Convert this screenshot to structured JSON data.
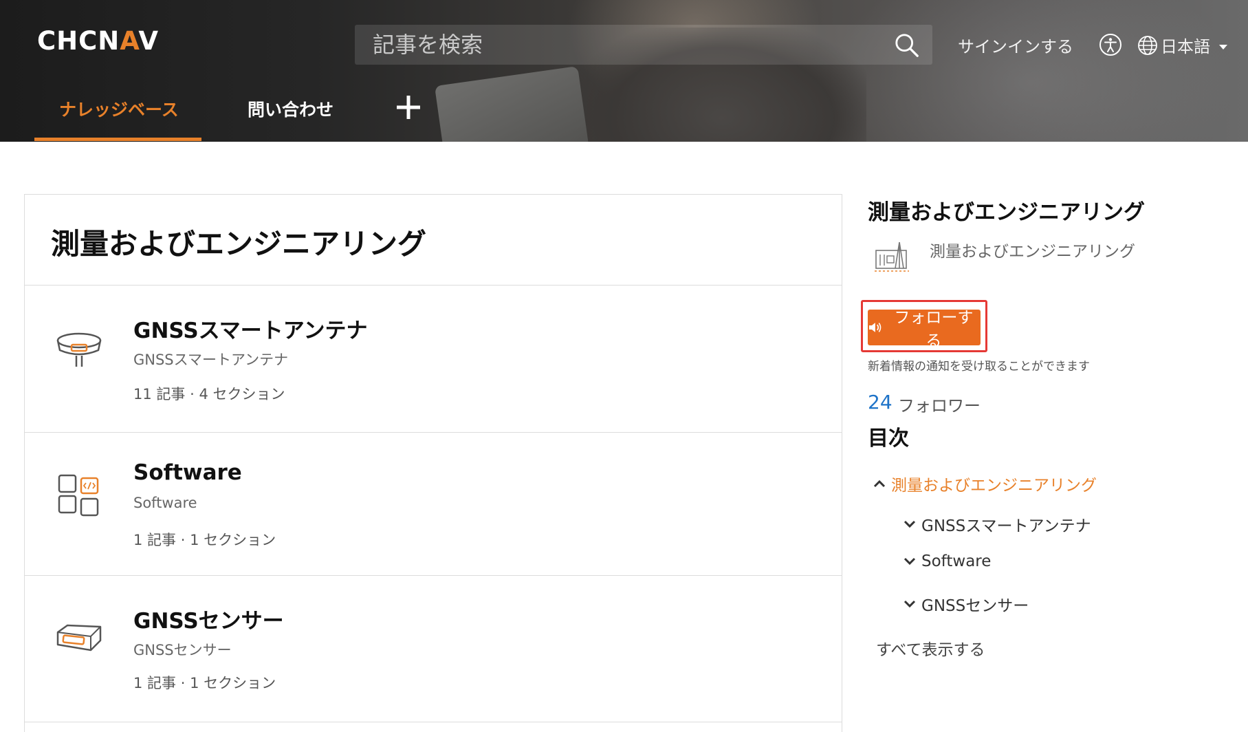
{
  "header": {
    "logo_text_1": "CHCN",
    "logo_text_accent": "A",
    "logo_text_2": "V",
    "search_placeholder": "記事を検索",
    "signin": "サインインする",
    "language": "日本語",
    "nav": {
      "knowledge_base": "ナレッジベース",
      "contact": "問い合わせ"
    }
  },
  "main": {
    "title": "測量およびエンジニアリング",
    "sections": [
      {
        "title": "GNSSスマートアンテナ",
        "subtitle": "GNSSスマートアンテナ",
        "articles": "11 記事",
        "sections": "· 4 セクション",
        "icon": "gnss-antenna-icon"
      },
      {
        "title": "Software",
        "subtitle": "Software",
        "articles": "1 記事",
        "sections": "· 1 セクション",
        "icon": "software-icon"
      },
      {
        "title": "GNSSセンサー",
        "subtitle": "GNSSセンサー",
        "articles": "1 記事",
        "sections": "· 1 セクション",
        "icon": "gnss-sensor-icon"
      }
    ]
  },
  "sidebar": {
    "title": "測量およびエンジニアリング",
    "category_name": "測量およびエンジニアリング",
    "follow_button": "フォローする",
    "follow_note": "新着情報の通知を受け取ることができます",
    "follower_count": "24",
    "follower_label": "フォロワー",
    "toc_title": "目次",
    "toc": {
      "root": "測量およびエンジニアリング",
      "children": [
        "GNSSスマートアンテナ",
        "Software",
        "GNSSセンサー"
      ]
    },
    "show_all": "すべて表示する"
  },
  "colors": {
    "accent": "#e8812a",
    "button": "#e96a1f",
    "highlight": "#e53935",
    "link_blue": "#1e73c8"
  }
}
